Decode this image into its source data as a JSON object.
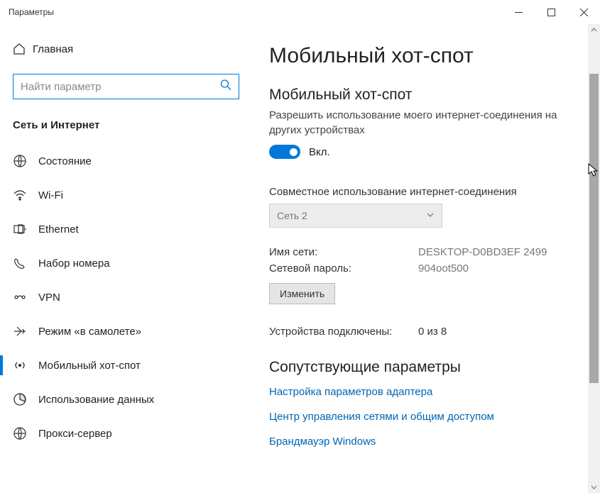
{
  "window": {
    "title": "Параметры"
  },
  "sidebar": {
    "home": "Главная",
    "search_placeholder": "Найти параметр",
    "category": "Сеть и Интернет",
    "items": [
      {
        "label": "Состояние"
      },
      {
        "label": "Wi-Fi"
      },
      {
        "label": "Ethernet"
      },
      {
        "label": "Набор номера"
      },
      {
        "label": "VPN"
      },
      {
        "label": "Режим «в самолете»"
      },
      {
        "label": "Мобильный хот-спот"
      },
      {
        "label": "Использование данных"
      },
      {
        "label": "Прокси-сервер"
      }
    ]
  },
  "main": {
    "title": "Мобильный хот-спот",
    "section_title": "Мобильный хот-спот",
    "section_desc": "Разрешить использование моего интернет-соединения на других устройствах",
    "toggle_state": "Вкл.",
    "share_label": "Совместное использование интернет-соединения",
    "share_selected": "Сеть 2",
    "net_name_label": "Имя сети:",
    "net_name_value": "DESKTOP-D0BD3EF 2499",
    "net_pass_label": "Сетевой пароль:",
    "net_pass_value": "904oot500",
    "edit_button": "Изменить",
    "devices_label": "Устройства подключены:",
    "devices_value": "0 из 8",
    "related_title": "Сопутствующие параметры",
    "links": [
      "Настройка параметров адаптера",
      "Центр управления сетями и общим доступом",
      "Брандмауэр Windows"
    ]
  }
}
